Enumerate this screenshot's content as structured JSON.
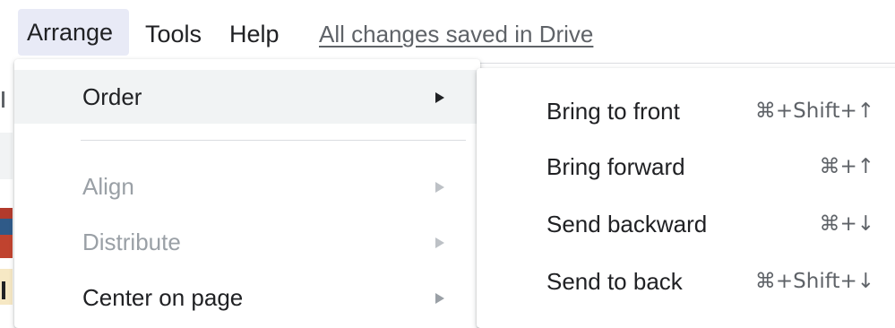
{
  "menubar": {
    "items": [
      {
        "label": "Arrange"
      },
      {
        "label": "Tools"
      },
      {
        "label": "Help"
      }
    ],
    "save_status": "All changes saved in Drive"
  },
  "arrange_menu": {
    "items": [
      {
        "label": "Order",
        "has_submenu": true,
        "disabled": false
      },
      {
        "label": "Align",
        "has_submenu": true,
        "disabled": true
      },
      {
        "label": "Distribute",
        "has_submenu": true,
        "disabled": true
      },
      {
        "label": "Center on page",
        "has_submenu": true,
        "disabled": false
      }
    ]
  },
  "order_submenu": {
    "items": [
      {
        "label": "Bring to front",
        "shortcut": "⌘+Shift+↑"
      },
      {
        "label": "Bring forward",
        "shortcut": "⌘+↑"
      },
      {
        "label": "Send backward",
        "shortcut": "⌘+↓"
      },
      {
        "label": "Send to back",
        "shortcut": "⌘+Shift+↓"
      }
    ]
  },
  "colors": {
    "active_menu_bg": "#e8eaf6",
    "highlight_bg": "#f1f3f4",
    "disabled_text": "#9aa0a6",
    "text": "#202124"
  },
  "icons": {
    "submenu_arrow": "triangle-right-icon"
  }
}
